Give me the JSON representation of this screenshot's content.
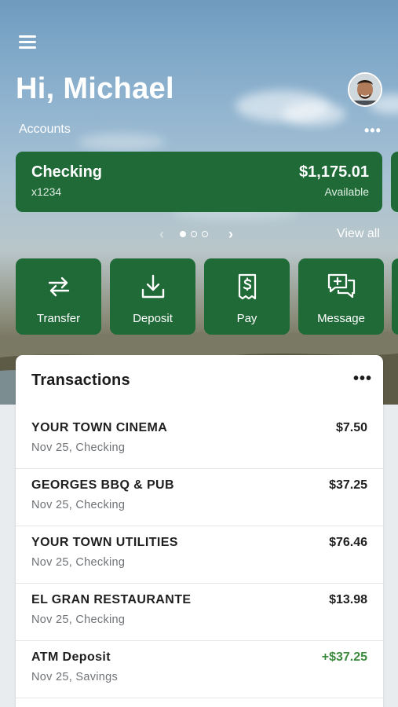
{
  "header": {
    "greeting": "Hi, Michael",
    "accounts_label": "Accounts",
    "more_icon": "ellipsis-icon",
    "menu_icon": "hamburger-icon",
    "avatar_icon": "user-avatar"
  },
  "account_card": {
    "name": "Checking",
    "number": "x1234",
    "balance": "$1,175.01",
    "balance_label": "Available"
  },
  "pager": {
    "current": 1,
    "total": 3,
    "view_all": "View all"
  },
  "actions": [
    {
      "label": "Transfer",
      "icon": "transfer-arrows-icon"
    },
    {
      "label": "Deposit",
      "icon": "download-tray-icon"
    },
    {
      "label": "Pay",
      "icon": "dollar-receipt-icon"
    },
    {
      "label": "Message",
      "icon": "chat-plus-icon"
    }
  ],
  "transactions": {
    "title": "Transactions",
    "items": [
      {
        "name": "YOUR TOWN CINEMA",
        "detail": "Nov 25, Checking",
        "amount": "$7.50"
      },
      {
        "name": "GEORGES BBQ & PUB",
        "detail": "Nov 25, Checking",
        "amount": "$37.25"
      },
      {
        "name": "YOUR TOWN UTILITIES",
        "detail": "Nov 25, Checking",
        "amount": "$76.46"
      },
      {
        "name": "EL GRAN RESTAURANTE",
        "detail": "Nov 25, Checking",
        "amount": "$13.98"
      },
      {
        "name": "ATM Deposit",
        "detail": "Nov 25, Savings",
        "amount": "+$37.25"
      }
    ]
  },
  "colors": {
    "brand_green": "#1f6a37",
    "positive_green": "#3c8a3f"
  }
}
